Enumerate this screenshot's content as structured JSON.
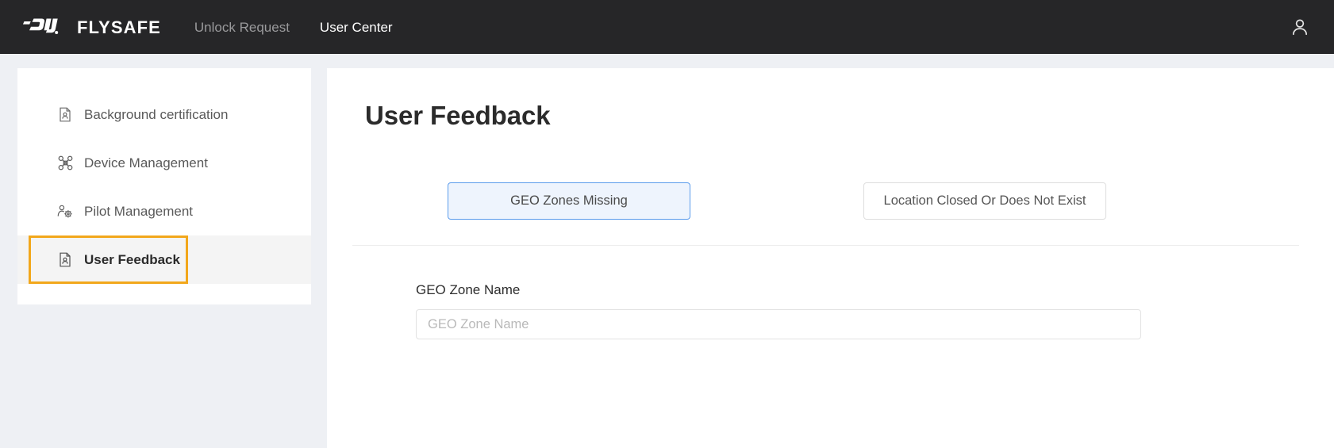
{
  "header": {
    "brand_mark": "dji-logo-icon",
    "brand_word": "FLYSAFE",
    "nav": [
      {
        "label": "Unlock Request",
        "active": false
      },
      {
        "label": "User Center",
        "active": true
      }
    ],
    "account_icon": "user-avatar-icon"
  },
  "sidebar": {
    "items": [
      {
        "label": "Background certification",
        "icon": "document-person-icon",
        "selected": false
      },
      {
        "label": "Device Management",
        "icon": "drone-quadcopter-icon",
        "selected": false
      },
      {
        "label": "Pilot Management",
        "icon": "person-gear-icon",
        "selected": false
      },
      {
        "label": "User Feedback",
        "icon": "document-person-icon",
        "selected": true
      }
    ]
  },
  "main": {
    "title": "User Feedback",
    "choices": [
      {
        "label": "GEO Zones Missing",
        "active": true
      },
      {
        "label": "Location Closed Or Does Not Exist",
        "active": false
      }
    ],
    "form": {
      "geo_zone_name": {
        "label": "GEO Zone Name",
        "placeholder": "GEO Zone Name",
        "value": ""
      }
    }
  },
  "colors": {
    "topbar_bg": "#262628",
    "page_bg": "#eef0f4",
    "highlight_orange": "#f2a71b",
    "accent_blue": "#5a9bec",
    "selected_row_bg": "#f4f4f4"
  }
}
